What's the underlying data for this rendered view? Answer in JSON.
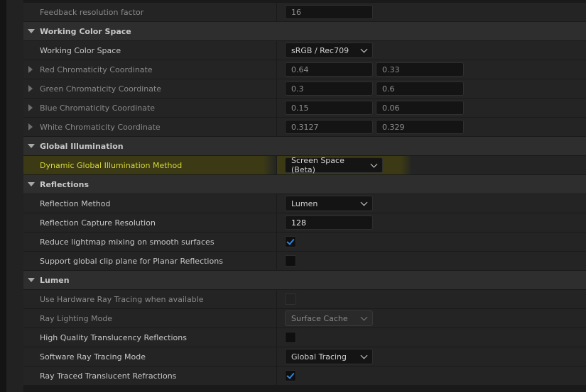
{
  "rows": [
    {
      "type": "prop",
      "label": "Feedback resolution factor",
      "dim": true,
      "value": "16"
    },
    {
      "type": "section",
      "label": "Working Color Space"
    },
    {
      "type": "prop",
      "label": "Working Color Space",
      "dropdown": "sRGB / Rec709"
    },
    {
      "type": "prop",
      "label": "Red Chromaticity Coordinate",
      "dim": true,
      "expandable": true,
      "values": [
        "0.64",
        "0.33"
      ]
    },
    {
      "type": "prop",
      "label": "Green Chromaticity Coordinate",
      "dim": true,
      "expandable": true,
      "values": [
        "0.3",
        "0.6"
      ]
    },
    {
      "type": "prop",
      "label": "Blue Chromaticity Coordinate",
      "dim": true,
      "expandable": true,
      "values": [
        "0.15",
        "0.06"
      ]
    },
    {
      "type": "prop",
      "label": "White Chromaticity Coordinate",
      "dim": true,
      "expandable": true,
      "values": [
        "0.3127",
        "0.329"
      ]
    },
    {
      "type": "section",
      "label": "Global Illumination"
    },
    {
      "type": "prop",
      "label": "Dynamic Global Illumination Method",
      "highlight": true,
      "dropdown": "Screen Space (Beta)",
      "wide": true
    },
    {
      "type": "section",
      "label": "Reflections"
    },
    {
      "type": "prop",
      "label": "Reflection Method",
      "dropdown": "Lumen"
    },
    {
      "type": "prop",
      "label": "Reflection Capture Resolution",
      "value": "128",
      "bright": true
    },
    {
      "type": "prop",
      "label": "Reduce lightmap mixing on smooth surfaces",
      "checkbox": true,
      "checked": true
    },
    {
      "type": "prop",
      "label": "Support global clip plane for Planar Reflections",
      "checkbox": true,
      "checked": false
    },
    {
      "type": "section",
      "label": "Lumen"
    },
    {
      "type": "prop",
      "label": "Use Hardware Ray Tracing when available",
      "dim": true,
      "checkbox": true,
      "checked": false,
      "disabled": true
    },
    {
      "type": "prop",
      "label": "Ray Lighting Mode",
      "dim": true,
      "dropdown": "Surface Cache",
      "disabled": true
    },
    {
      "type": "prop",
      "label": "High Quality Translucency Reflections",
      "checkbox": true,
      "checked": false
    },
    {
      "type": "prop",
      "label": "Software Ray Tracing Mode",
      "dropdown": "Global Tracing"
    },
    {
      "type": "prop",
      "label": "Ray Traced Translucent Refractions",
      "checkbox": true,
      "checked": true
    }
  ]
}
